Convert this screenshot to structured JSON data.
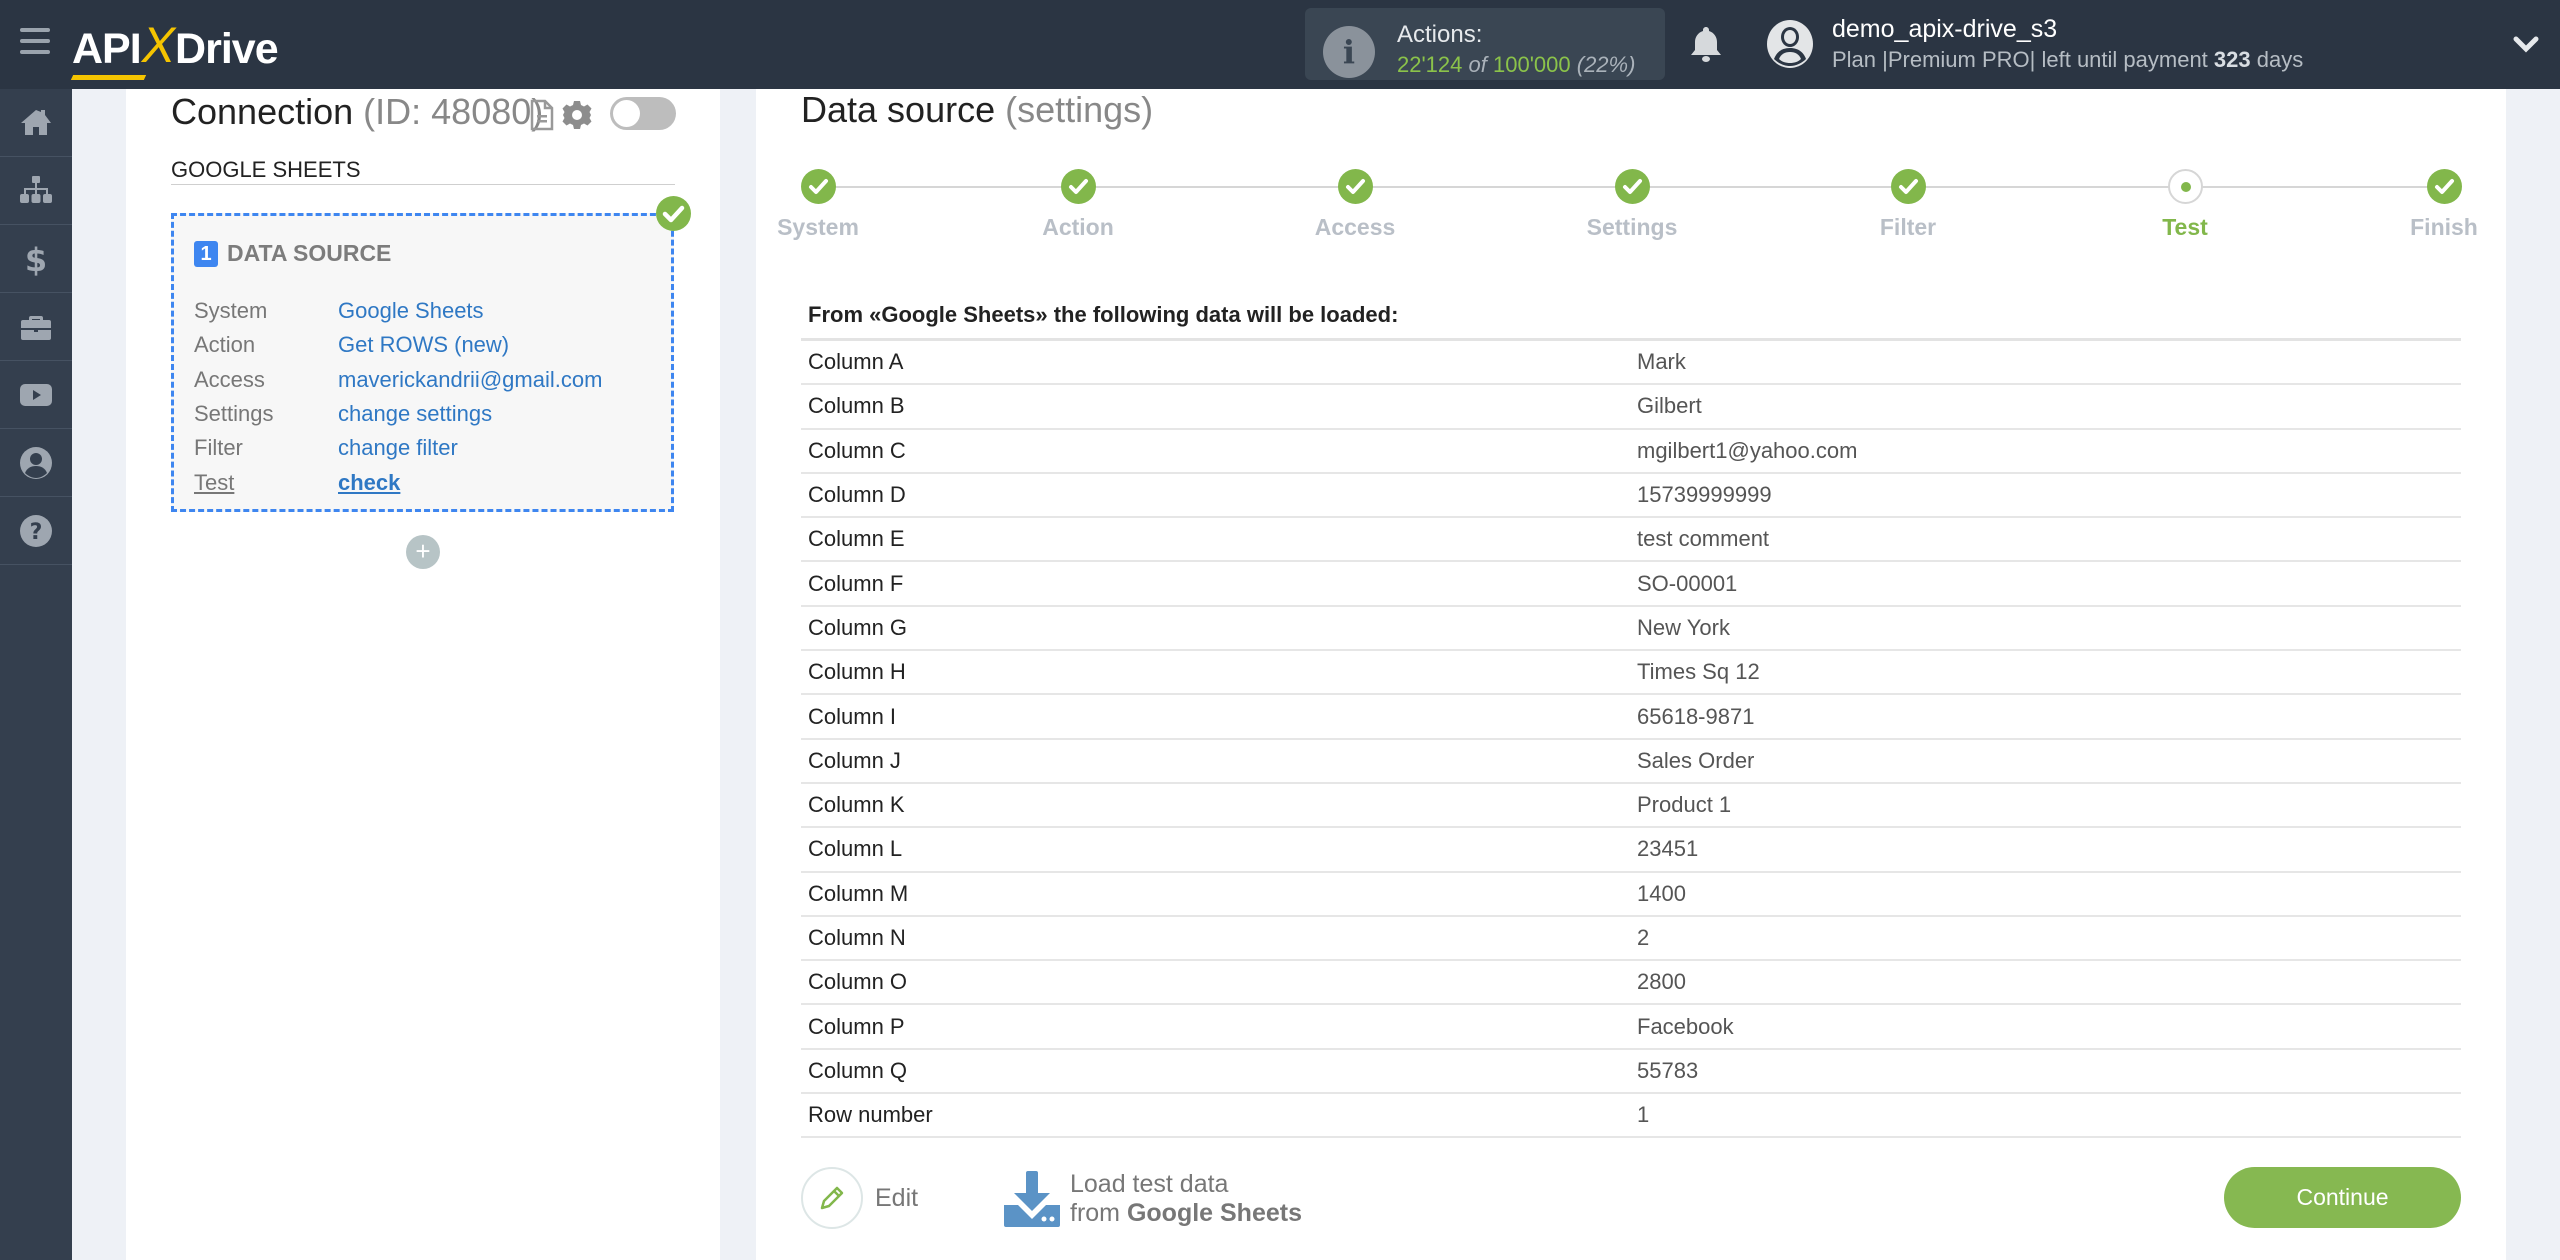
{
  "header": {
    "logo": {
      "api": "API",
      "x": "X",
      "drive": "Drive"
    },
    "actions": {
      "label": "Actions:",
      "used": "22'124",
      "of": "of",
      "total": "100'000",
      "percent": "(22%)"
    },
    "user": {
      "name": "demo_apix-drive_s3",
      "plan_prefix": "Plan |Premium PRO| left until payment",
      "days": "323",
      "days_suffix": "days"
    }
  },
  "sidebar": {
    "items": [
      {
        "name": "home",
        "icon": "home-icon"
      },
      {
        "name": "connections",
        "icon": "sitemap-icon"
      },
      {
        "name": "billing",
        "icon": "dollar-icon"
      },
      {
        "name": "tools",
        "icon": "briefcase-icon"
      },
      {
        "name": "videos",
        "icon": "youtube-icon"
      },
      {
        "name": "account",
        "icon": "user-circle-icon"
      },
      {
        "name": "help",
        "icon": "question-circle-icon"
      }
    ]
  },
  "connection": {
    "title": "Connection",
    "id_text": "(ID: 48080)",
    "system_name": "GOOGLE SHEETS",
    "toggle_on": false,
    "data_source": {
      "number": "1",
      "title": "DATA SOURCE",
      "rows": [
        {
          "key": "System",
          "value": "Google Sheets"
        },
        {
          "key": "Action",
          "value": "Get ROWS (new)"
        },
        {
          "key": "Access",
          "value": "maverickandrii@gmail.com"
        },
        {
          "key": "Settings",
          "value": "change settings"
        },
        {
          "key": "Filter",
          "value": "change filter"
        },
        {
          "key": "Test",
          "value": "check"
        }
      ]
    },
    "add_label": "+"
  },
  "main": {
    "title": "Data source",
    "subtitle": "(settings)",
    "steps": [
      {
        "label": "System",
        "state": "done"
      },
      {
        "label": "Action",
        "state": "done"
      },
      {
        "label": "Access",
        "state": "done"
      },
      {
        "label": "Settings",
        "state": "done"
      },
      {
        "label": "Filter",
        "state": "done"
      },
      {
        "label": "Test",
        "state": "current"
      },
      {
        "label": "Finish",
        "state": "done"
      }
    ],
    "caption": "From «Google Sheets» the following data will be loaded:",
    "rows": [
      {
        "column": "Column A",
        "value": "Mark"
      },
      {
        "column": "Column B",
        "value": "Gilbert"
      },
      {
        "column": "Column C",
        "value": "mgilbert1@yahoo.com"
      },
      {
        "column": "Column D",
        "value": "15739999999"
      },
      {
        "column": "Column E",
        "value": "test comment"
      },
      {
        "column": "Column F",
        "value": "SO-00001"
      },
      {
        "column": "Column G",
        "value": "New York"
      },
      {
        "column": "Column H",
        "value": "Times Sq 12"
      },
      {
        "column": "Column I",
        "value": "65618-9871"
      },
      {
        "column": "Column J",
        "value": "Sales Order"
      },
      {
        "column": "Column K",
        "value": "Product 1"
      },
      {
        "column": "Column L",
        "value": "23451"
      },
      {
        "column": "Column M",
        "value": "1400"
      },
      {
        "column": "Column N",
        "value": "2"
      },
      {
        "column": "Column O",
        "value": "2800"
      },
      {
        "column": "Column P",
        "value": "Facebook"
      },
      {
        "column": "Column Q",
        "value": "55783"
      },
      {
        "column": "Row number",
        "value": "1"
      }
    ],
    "edit_label": "Edit",
    "load": {
      "line1": "Load test data",
      "line2_prefix": "from",
      "line2_system": "Google Sheets"
    },
    "continue_label": "Continue"
  },
  "colors": {
    "header_bg": "#2b3543",
    "sidebar_bg": "#343f4e",
    "accent_green": "#86b851",
    "link_blue": "#2f78c4",
    "dashed_blue": "#3e86f0",
    "logo_yellow": "#f5c400"
  }
}
